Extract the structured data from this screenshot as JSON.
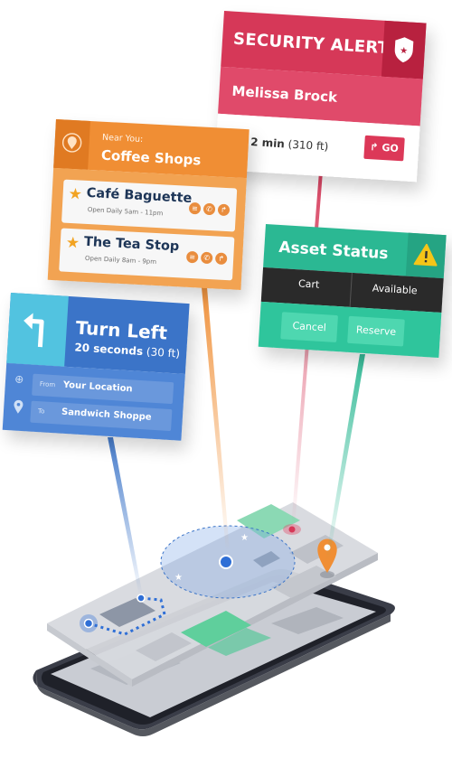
{
  "security_alert": {
    "title": "SECURITY ALERT",
    "name": "Melissa Brock",
    "time_bold": "2 min",
    "time_rest": "(310 ft)",
    "go_label": "GO",
    "icons": [
      "shield-icon",
      "map-pin-icon",
      "turn-arrow-icon"
    ]
  },
  "coffee": {
    "near_label": "Near You:",
    "title": "Coffee Shops",
    "shops": [
      {
        "name": "Café Baguette",
        "hours": "Open Daily 5am - 11pm"
      },
      {
        "name": "The Tea Stop",
        "hours": "Open Daily 8am - 9pm"
      }
    ],
    "icons": [
      "map-pin-icon",
      "star-icon",
      "menu-icon",
      "phone-icon",
      "directions-icon"
    ]
  },
  "turn": {
    "title": "Turn Left",
    "seconds_bold": "20 seconds",
    "seconds_rest": "(30 ft)",
    "from_label": "From",
    "from_value": "Your Location",
    "to_label": "To",
    "to_value": "Sandwich Shoppe",
    "icons": [
      "turn-left-arrow-icon",
      "crosshair-icon",
      "map-pin-icon"
    ]
  },
  "asset": {
    "title": "Asset Status",
    "item": "Cart",
    "status": "Available",
    "cancel_label": "Cancel",
    "reserve_label": "Reserve",
    "icons": [
      "warning-icon"
    ]
  },
  "colors": {
    "security": "#d63858",
    "coffee": "#f08e34",
    "turn": "#3b74c8",
    "asset": "#2bb893"
  }
}
